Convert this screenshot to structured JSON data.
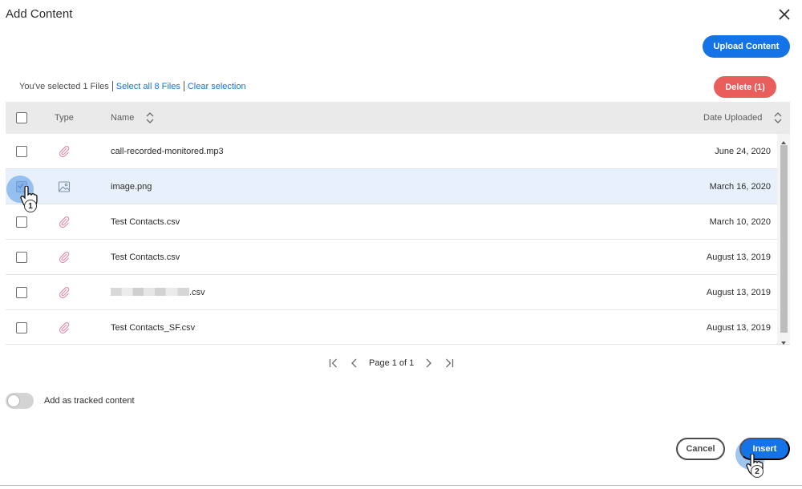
{
  "dialog": {
    "title": "Add Content",
    "close_icon": "close-icon"
  },
  "toolbar": {
    "upload_label": "Upload Content",
    "delete_label": "Delete (1)"
  },
  "selection": {
    "summary": "You've selected 1 Files",
    "select_all": "Select all 8 Files",
    "clear": "Clear selection"
  },
  "table": {
    "columns": {
      "type": "Type",
      "name": "Name",
      "date": "Date Uploaded"
    },
    "rows": [
      {
        "icon": "paperclip-icon",
        "name": "call-recorded-monitored.mp3",
        "date": "June 24, 2020",
        "selected": false
      },
      {
        "icon": "image-icon",
        "name": "image.png",
        "date": "March 16, 2020",
        "selected": true
      },
      {
        "icon": "paperclip-icon",
        "name": "Test Contacts.csv",
        "date": "March 10, 2020",
        "selected": false
      },
      {
        "icon": "paperclip-icon",
        "name": "Test Contacts.csv",
        "date": "August 13, 2019",
        "selected": false
      },
      {
        "icon": "paperclip-icon",
        "name": ".csv",
        "date": "August 13, 2019",
        "selected": false
      },
      {
        "icon": "paperclip-icon",
        "name": "Test Contacts_SF.csv",
        "date": "August 13, 2019",
        "selected": false
      }
    ]
  },
  "pagination": {
    "text": "Page 1 of 1"
  },
  "tracked": {
    "label": "Add as tracked content",
    "on": false
  },
  "footer": {
    "cancel_label": "Cancel",
    "insert_label": "Insert"
  },
  "annotations": {
    "step1": "1",
    "step2": "2"
  },
  "colors": {
    "accent": "#1473e6",
    "danger": "#ea5d5d",
    "selected_row": "#e8f1fb"
  }
}
